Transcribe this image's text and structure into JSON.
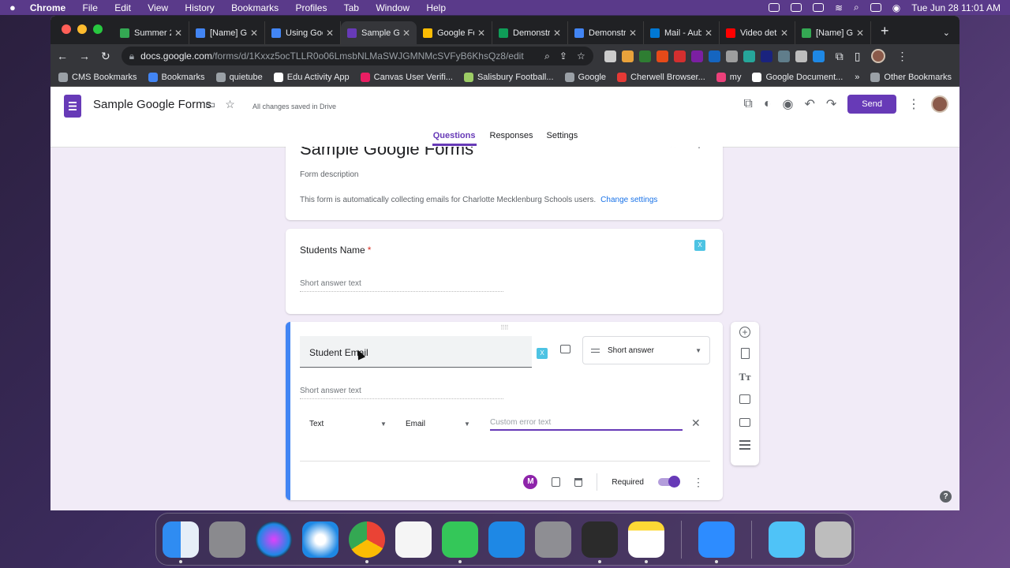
{
  "menubar": {
    "app": "Chrome",
    "items": [
      "File",
      "Edit",
      "View",
      "History",
      "Bookmarks",
      "Profiles",
      "Tab",
      "Window",
      "Help"
    ],
    "clock": "Tue Jun 28  11:01 AM"
  },
  "browser": {
    "tabs": [
      {
        "label": "Summer 2",
        "color": "#34a853",
        "active": false
      },
      {
        "label": "[Name] Go",
        "color": "#4285f4",
        "active": false
      },
      {
        "label": "Using Goo",
        "color": "#4285f4",
        "active": false
      },
      {
        "label": "Sample Go",
        "color": "#673ab7",
        "active": true
      },
      {
        "label": "Google Fo",
        "color": "#fbbc04",
        "active": false
      },
      {
        "label": "Demonstra",
        "color": "#0f9d58",
        "active": false
      },
      {
        "label": "Demonstra",
        "color": "#4285f4",
        "active": false
      },
      {
        "label": "Mail - Aub",
        "color": "#0078d4",
        "active": false
      },
      {
        "label": "Video det",
        "color": "#ff0000",
        "active": false
      },
      {
        "label": "[Name] Go",
        "color": "#34a853",
        "active": false
      }
    ],
    "url_host": "docs.google.com",
    "url_path": "/forms/d/1Kxxz5ocTLLR0o06LmsbNLMaSWJGMNMcSVFyB6KhsQz8/edit",
    "bookmarks": [
      "CMS Bookmarks",
      "Bookmarks",
      "quietube",
      "Edu Activity App",
      "Canvas User Verifi...",
      "Salisbury Football...",
      "Google",
      "Cherwell Browser...",
      "my",
      "Google Document..."
    ],
    "other_bookmarks": "Other Bookmarks",
    "overflow": "»"
  },
  "form": {
    "title": "Sample Google Forms",
    "saved_status": "All changes saved in Drive",
    "send_label": "Send",
    "tabs": [
      "Questions",
      "Responses",
      "Settings"
    ],
    "header_card": {
      "title": "Sample Google Forms",
      "description": "Form description",
      "collecting_notice": "This form is automatically collecting emails for Charlotte Mecklenburg Schools users.",
      "change_settings": "Change settings"
    },
    "question1": {
      "label": "Students Name",
      "required_mark": "*",
      "placeholder": "Short answer text"
    },
    "question2": {
      "label": "Student Email",
      "type": "Short answer",
      "placeholder": "Short answer text",
      "validation_type": "Text",
      "validation_rule": "Email",
      "error_placeholder": "Custom error text",
      "required_label": "Required",
      "required": true
    }
  },
  "icons": {
    "ext_badge": "X"
  }
}
